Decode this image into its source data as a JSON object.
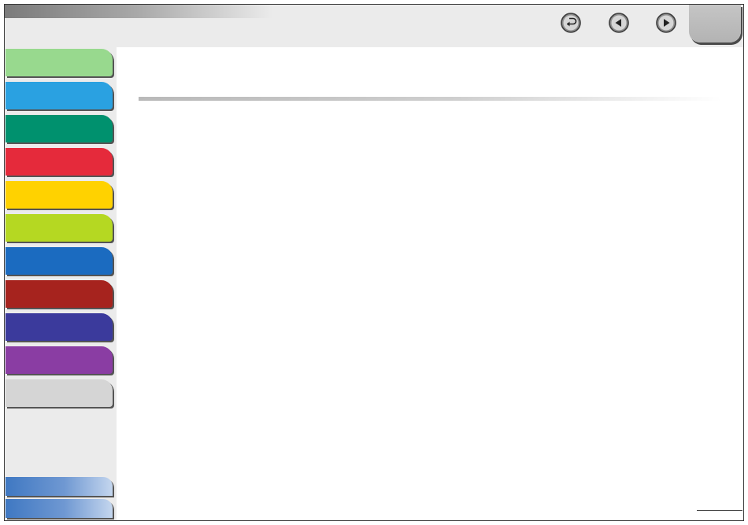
{
  "header": {
    "page_number": "",
    "nav": {
      "back_icon": "return-arrow-icon",
      "prev_icon": "triangle-left-icon",
      "next_icon": "triangle-right-icon"
    }
  },
  "sidebar": {
    "tabs": [
      {
        "label": "",
        "color": "#98d98e"
      },
      {
        "label": "",
        "color": "#2aa1e1"
      },
      {
        "label": "",
        "color": "#00916e"
      },
      {
        "label": "",
        "color": "#e52a3b"
      },
      {
        "label": "",
        "color": "#ffd200"
      },
      {
        "label": "",
        "color": "#b5d822"
      },
      {
        "label": "",
        "color": "#1b6bc0"
      },
      {
        "label": "",
        "color": "#a6231e"
      },
      {
        "label": "",
        "color": "#3b3a9c"
      },
      {
        "label": "",
        "color": "#8a3da3"
      },
      {
        "label": "",
        "color": "#d5d5d5"
      }
    ],
    "bottom_tabs": [
      {
        "label": ""
      },
      {
        "label": ""
      }
    ]
  },
  "content": {
    "title": ""
  }
}
